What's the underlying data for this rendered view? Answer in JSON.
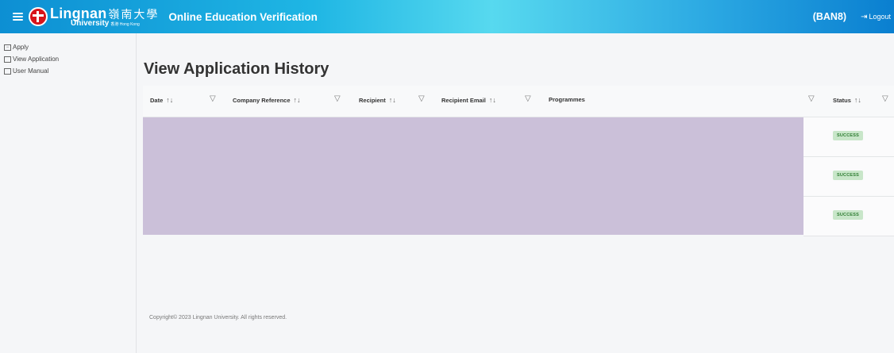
{
  "header": {
    "logo_name": "Lingnan",
    "logo_name_cn": "嶺南大學",
    "logo_sub": "University",
    "logo_sub_small": "香港 Hong Kong",
    "app_title": "Online Education Verification",
    "user_code": "(BAN8)",
    "logout_label": "Logout",
    "gradient_colors": [
      "#0d8fd3",
      "#57d9ef",
      "#0a7fd0"
    ]
  },
  "sidebar": {
    "items": [
      {
        "label": "Apply",
        "icon": "checkbox-icon"
      },
      {
        "label": "View Application",
        "icon": "folder-icon"
      },
      {
        "label": "User Manual",
        "icon": "book-icon"
      }
    ]
  },
  "main": {
    "title": "View Application History",
    "columns": [
      {
        "label": "Date",
        "sortable": true,
        "filterable": true
      },
      {
        "label": "Company Reference",
        "sortable": true,
        "filterable": true
      },
      {
        "label": "Recipient",
        "sortable": true,
        "filterable": true
      },
      {
        "label": "Recipient Email",
        "sortable": true,
        "filterable": true
      },
      {
        "label": "Programmes",
        "sortable": false,
        "filterable": true
      },
      {
        "label": "Status",
        "sortable": true,
        "filterable": true
      }
    ],
    "sort_glyph": "↑↓",
    "rows": [
      {
        "status": "SUCCESS"
      },
      {
        "status": "SUCCESS"
      },
      {
        "status": "SUCCESS"
      }
    ],
    "redaction_color": "#cbc0d9",
    "status_color": "#2e7d32"
  },
  "footer": {
    "copyright": "Copyright© 2023 Lingnan University. All rights reserved."
  }
}
